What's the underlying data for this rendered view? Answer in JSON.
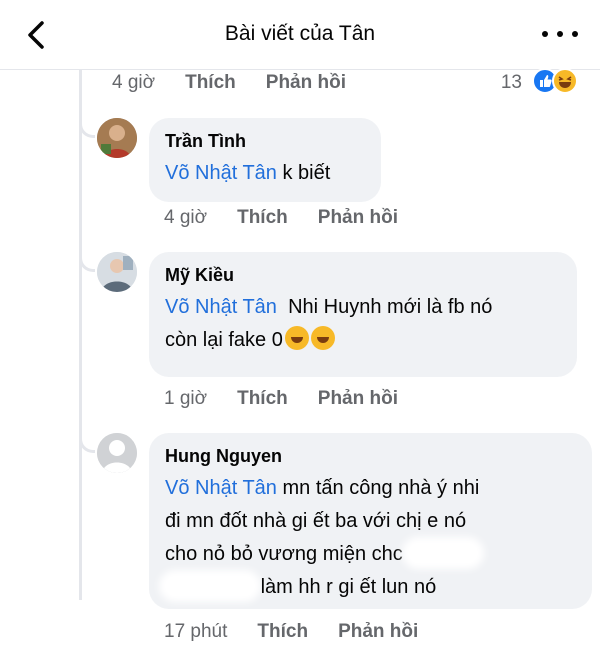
{
  "header": {
    "title": "Bài viết của Tân"
  },
  "top_comment": {
    "time": "4 giờ",
    "like": "Thích",
    "reply": "Phản hồi",
    "reaction_count": "13"
  },
  "replies": [
    {
      "author": "Trần Tình",
      "mention": "Võ Nhật Tân",
      "text_1": "k biết",
      "time": "4 giờ",
      "like": "Thích",
      "reply": "Phản hồi"
    },
    {
      "author": "Mỹ Kiều",
      "mention": "Võ Nhật Tân",
      "text_1": "Nhi Huynh mới là fb nó",
      "text_2": "còn lại fake 0",
      "time": "1 giờ",
      "like": "Thích",
      "reply": "Phản hồi"
    },
    {
      "author": "Hung Nguyen",
      "mention": "Võ Nhật Tân",
      "text_1": "mn tấn công nhà ý nhi",
      "text_2": "đi mn đốt nhà gi ết ba với chị e nó",
      "text_3": "cho nỏ bỏ vương miện chc",
      "text_4": "làm hh r gi ết lun nó",
      "time": "17 phút",
      "like": "Thích",
      "reply": "Phản hồi"
    }
  ],
  "icons": [
    "back-arrow-icon",
    "more-dots-icon",
    "like-reaction-icon",
    "haha-reaction-icon",
    "laughing-emoji-icon"
  ],
  "colors": {
    "mention": "#216fdb",
    "bubble": "#f0f2f5",
    "meta": "#65676b",
    "like": "#1877f2",
    "haha": "#f7b928"
  }
}
